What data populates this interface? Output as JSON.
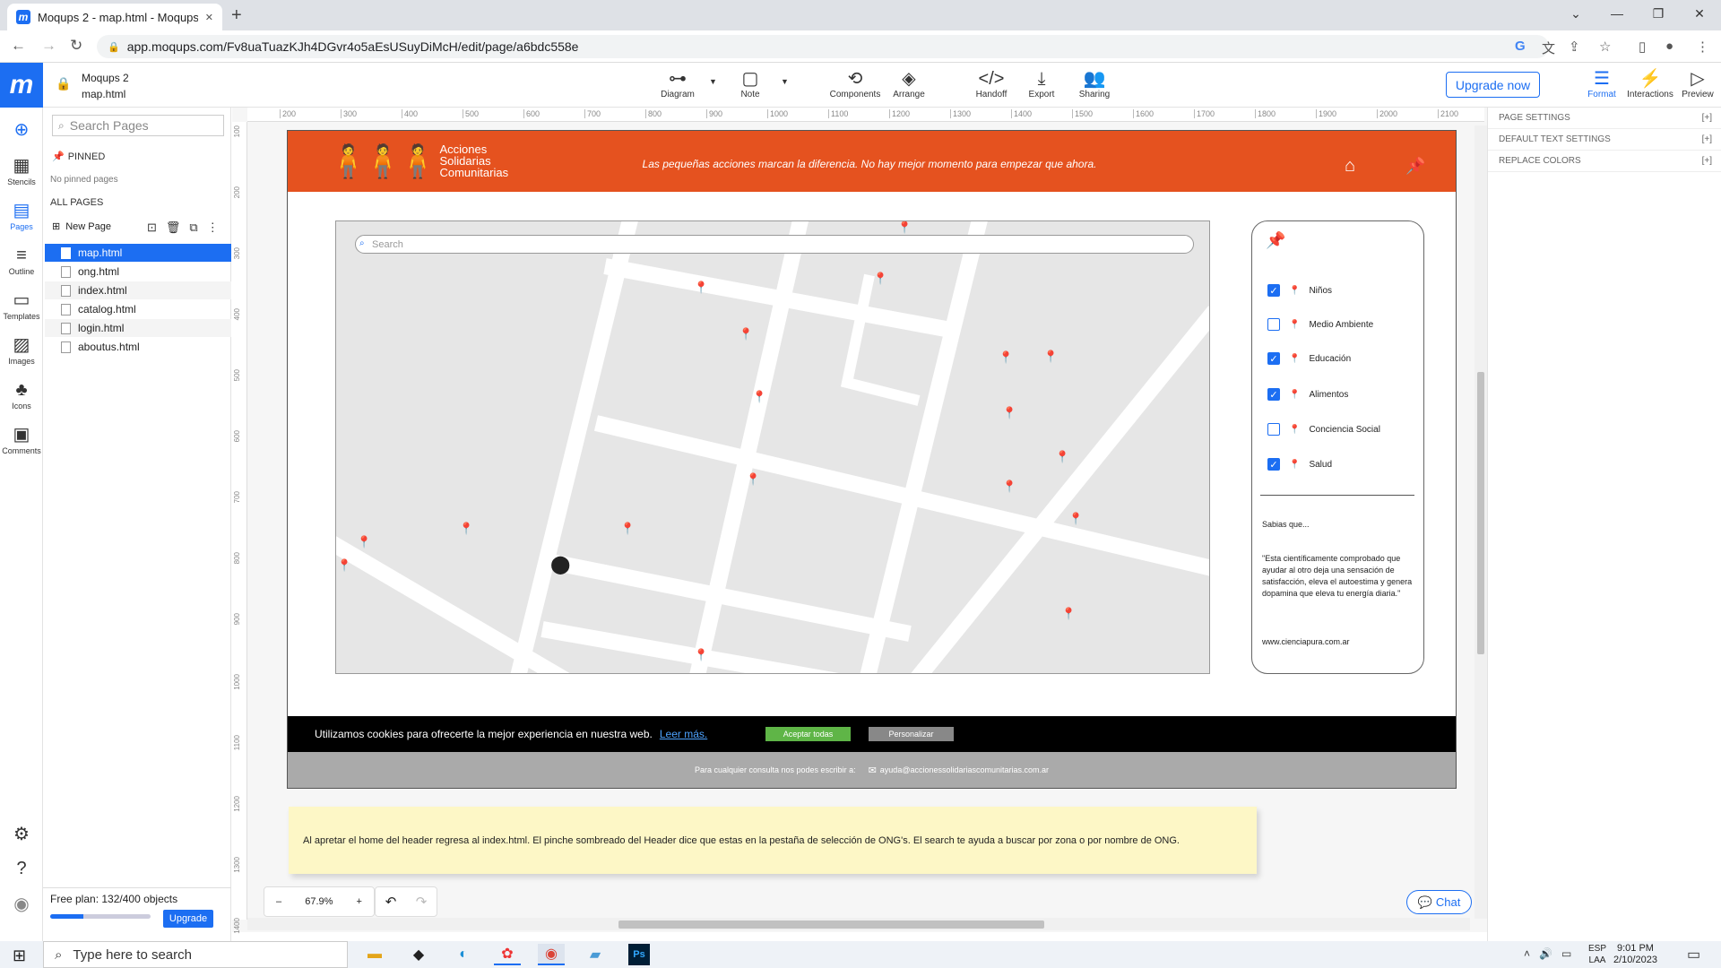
{
  "browser": {
    "tab_title": "Moqups 2 - map.html - Moqups",
    "tab_close": "✕",
    "new_tab": "+",
    "url": "app.moqups.com/Fv8uaTuazKJh4DGvr4o5aEsUSuyDiMcH/edit/page/a6bdc558e"
  },
  "app": {
    "logo": "m",
    "project_name": "Moqups 2",
    "page_name": "map.html",
    "toolbar": [
      {
        "label": "Diagram",
        "icon": "diagram-icon"
      },
      {
        "label": "Note",
        "icon": "note-icon"
      },
      {
        "label": "Components",
        "icon": "components-icon"
      },
      {
        "label": "Arrange",
        "icon": "arrange-icon"
      },
      {
        "label": "Handoff",
        "icon": "code-icon"
      },
      {
        "label": "Export",
        "icon": "download-icon"
      },
      {
        "label": "Sharing",
        "icon": "share-user-icon"
      }
    ],
    "upgrade_label": "Upgrade now",
    "right_tools": [
      {
        "label": "Format",
        "icon": "sliders-icon"
      },
      {
        "label": "Interactions",
        "icon": "lightning-icon"
      },
      {
        "label": "Preview",
        "icon": "play-icon"
      }
    ],
    "accent": "#1c6ef2"
  },
  "rail": {
    "items": [
      "Stencils",
      "Pages",
      "Outline",
      "Templates",
      "Images",
      "Icons",
      "Comments"
    ]
  },
  "pages_panel": {
    "search_placeholder": "Search Pages",
    "pinned_header": "PINNED",
    "pinned_empty": "No pinned pages",
    "all_pages_header": "ALL PAGES",
    "new_page_label": "New Page",
    "pages": [
      "map.html",
      "ong.html",
      "index.html",
      "catalog.html",
      "login.html",
      "aboutus.html"
    ],
    "selected": "map.html",
    "plan_text": "Free plan: 132/400 objects",
    "plan_used": 132,
    "plan_total": 400,
    "upgrade_small": "Upgrade"
  },
  "ruler": {
    "top": [
      "200",
      "300",
      "400",
      "500",
      "600",
      "700",
      "800",
      "900",
      "1000",
      "1100",
      "1200",
      "1300",
      "1400",
      "1500",
      "1600",
      "1700",
      "1800",
      "1900",
      "2000",
      "2100"
    ],
    "left": [
      "100",
      "200",
      "300",
      "400",
      "500",
      "600",
      "700",
      "800",
      "900",
      "1000",
      "1100",
      "1200",
      "1300",
      "1400"
    ]
  },
  "design": {
    "brand_line1": "Acciones",
    "brand_line2": "Solidarias",
    "brand_line3": "Comunitarias",
    "tagline": "Las pequeñas acciones marcan la diferencia. No hay mejor momento para empezar que ahora.",
    "header_color": "#e5521f",
    "map_search_placeholder": "Search",
    "filters": [
      {
        "label": "Niños",
        "checked": true,
        "color": "#b33bdb"
      },
      {
        "label": "Medio Ambiente",
        "checked": false,
        "color": "#f07a3e"
      },
      {
        "label": "Educación",
        "checked": true,
        "color": "#6b9cf2"
      },
      {
        "label": "Alimentos",
        "checked": true,
        "color": "#5cc24a"
      },
      {
        "label": "Conciencia Social",
        "checked": false,
        "color": "#d4b21f"
      },
      {
        "label": "Salud",
        "checked": true,
        "color": "#e33b3b"
      }
    ],
    "sabias_title": "Sabias que...",
    "sabias_quote": "\"Esta científicamente comprobado que ayudar al otro deja una sensación de satisfacción, eleva el autoestima y genera dopamina que eleva tu energía diaria.\"",
    "sabias_link": "www.cienciapura.com.ar",
    "cookie_text": "Utilizamos cookies para ofrecerte la mejor experiencia en nuestra web.",
    "cookie_link": "Leer más.",
    "accept_label": "Aceptar todas",
    "customize_label": "Personalizar",
    "footer_text": "Para cualquier consulta nos podes escribir a:",
    "footer_email": "ayuda@accionessolidariascomunitarias.com.ar",
    "note_text": "Al apretar el home del header regresa al index.html. El pinche sombreado del Header dice que estas en la pestaña de selección de ONG's. El search te ayuda a buscar por zona o por nombre de ONG."
  },
  "zoom": {
    "minus": "–",
    "value": "67.9%",
    "plus": "+"
  },
  "chat_label": "Chat",
  "right_panel": {
    "sections": [
      "PAGE SETTINGS",
      "DEFAULT TEXT SETTINGS",
      "REPLACE COLORS"
    ],
    "expand": "[+]"
  },
  "taskbar": {
    "search_placeholder": "Type here to search",
    "lang1": "ESP",
    "lang2": "LAA",
    "time": "9:01 PM",
    "date": "2/10/2023"
  }
}
